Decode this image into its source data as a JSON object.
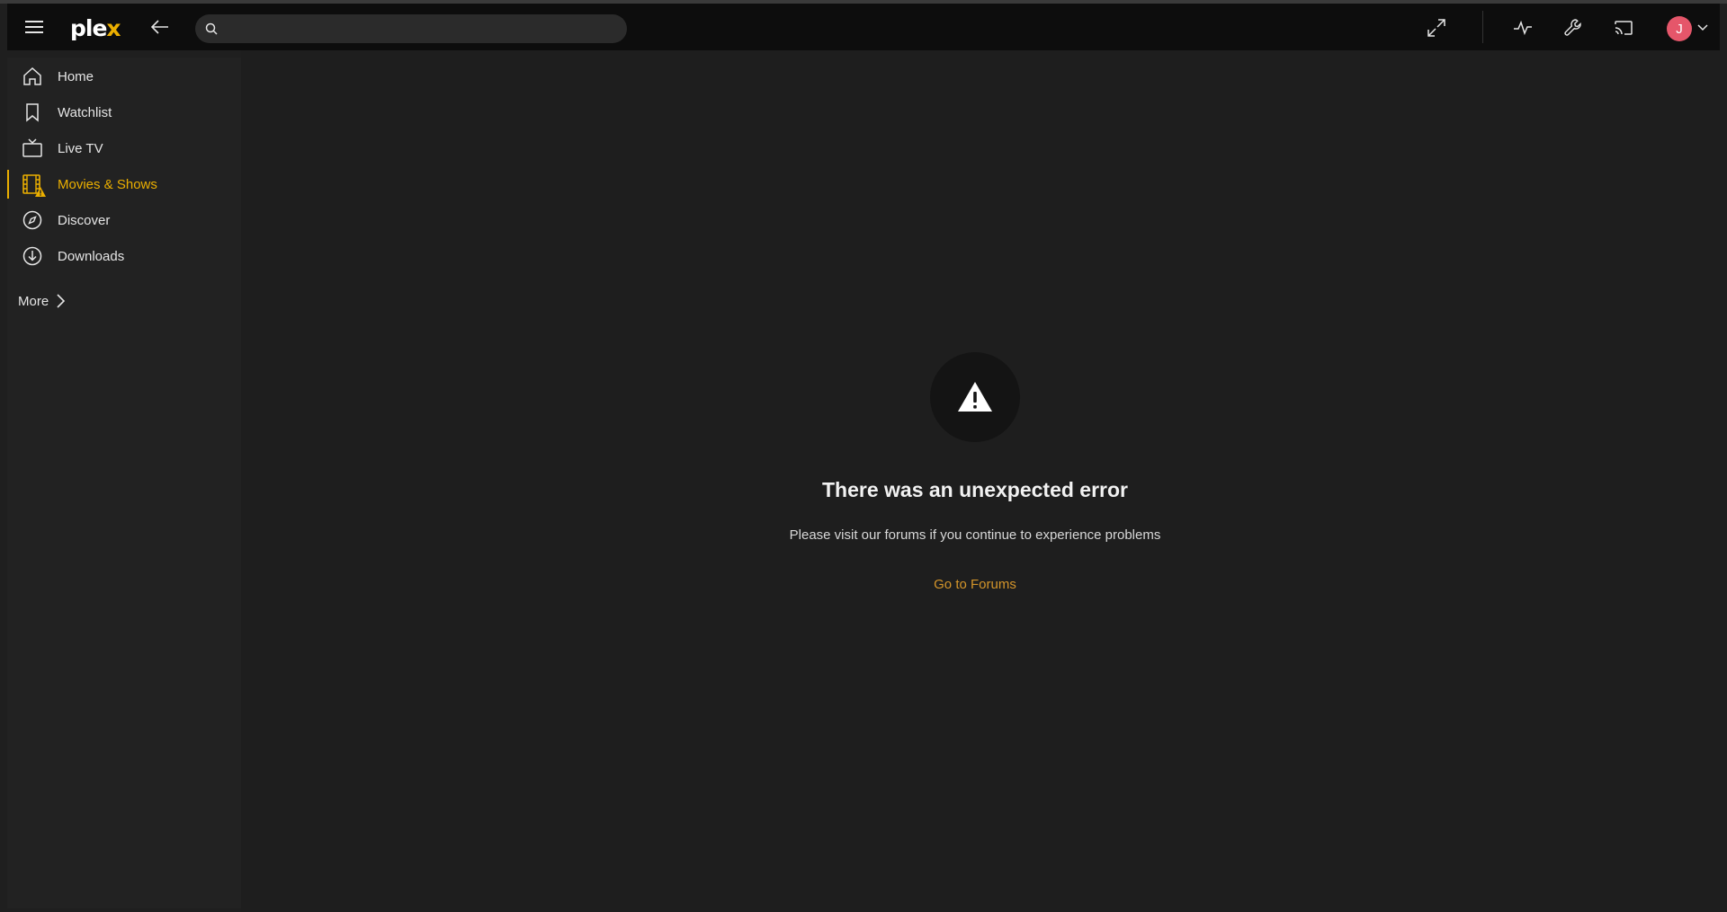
{
  "app": {
    "logo_main": "ple",
    "logo_x": "x"
  },
  "search": {
    "value": "",
    "placeholder": ""
  },
  "sidebar": {
    "items": [
      {
        "label": "Home",
        "icon": "home-icon",
        "active": false
      },
      {
        "label": "Watchlist",
        "icon": "bookmark-icon",
        "active": false
      },
      {
        "label": "Live TV",
        "icon": "tv-icon",
        "active": false
      },
      {
        "label": "Movies & Shows",
        "icon": "film-warning-icon",
        "active": true
      },
      {
        "label": "Discover",
        "icon": "compass-icon",
        "active": false
      },
      {
        "label": "Downloads",
        "icon": "download-icon",
        "active": false
      }
    ],
    "more_label": "More"
  },
  "topbar": {
    "avatar_initial": "J",
    "icons": [
      "fullscreen-icon",
      "activity-icon",
      "wrench-icon",
      "cast-icon"
    ]
  },
  "error": {
    "title": "There was an unexpected error",
    "message": "Please visit our forums if you continue to experience problems",
    "link_label": "Go to Forums"
  },
  "colors": {
    "accent": "#ebaf00",
    "link": "#d4952a",
    "avatar": "#e5566a",
    "background": "#1f1f1f"
  }
}
